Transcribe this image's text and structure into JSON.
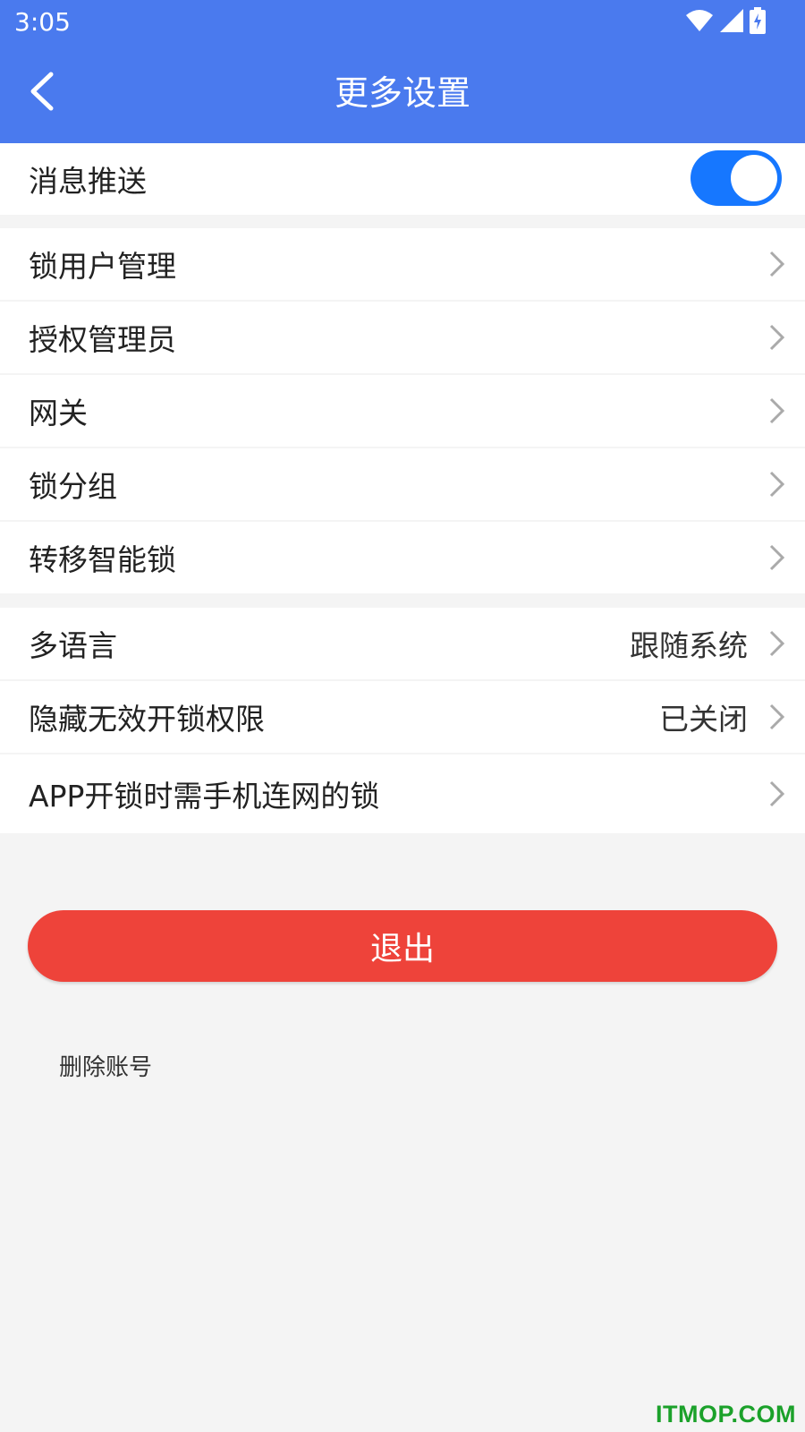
{
  "status_bar": {
    "time": "3:05",
    "icons": [
      "wifi-icon",
      "signal-icon",
      "battery-charging-icon"
    ]
  },
  "header": {
    "title": "更多设置",
    "back_icon": "chevron-left-icon"
  },
  "push": {
    "label": "消息推送",
    "enabled": true
  },
  "group1": [
    {
      "label": "锁用户管理"
    },
    {
      "label": "授权管理员"
    },
    {
      "label": "网关"
    },
    {
      "label": "锁分组"
    },
    {
      "label": "转移智能锁"
    }
  ],
  "group2": [
    {
      "label": "多语言",
      "value": "跟随系统"
    },
    {
      "label": "隐藏无效开锁权限",
      "value": "已关闭"
    },
    {
      "label": "APP开锁时需手机连网的锁",
      "value": ""
    }
  ],
  "logout": {
    "label": "退出"
  },
  "delete_account": {
    "label": "删除账号"
  },
  "watermark": "ITMOP.COM",
  "colors": {
    "header": "#4a7aee",
    "toggle_on": "#1677ff",
    "logout": "#ee433a",
    "watermark": "#1ba12a"
  }
}
